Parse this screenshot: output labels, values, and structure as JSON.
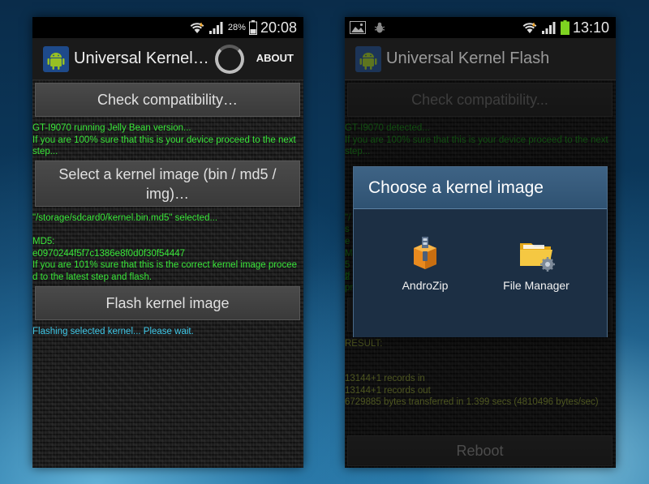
{
  "left_screen": {
    "status": {
      "battery_pct": "28%",
      "time": "20:08"
    },
    "actionbar": {
      "title": "Universal Kernel…",
      "about": "ABOUT"
    },
    "check_button": "Check compatibility…",
    "device_message": "GT-I9070 running Jelly Bean version...\nIf you are 100% sure that this is your device proceed to the next step...",
    "select_button": "Select a kernel image (bin / md5 / img)…",
    "selected_message": "\"/storage/sdcard0/kernel.bin.md5\" selected...",
    "md5_message": "MD5:\ne0970244f5f7c1386e8f0d0f30f54447\nIf you are 101% sure that this is the correct kernel image proceed to the latest step and flash.",
    "flash_button": "Flash kernel image",
    "flash_status": "Flashing selected kernel... Please wait."
  },
  "right_screen": {
    "status": {
      "time": "13:10"
    },
    "actionbar": {
      "title": "Universal Kernel Flash"
    },
    "check_button": "Check compatibility...",
    "device_message": "GT-I9070 detected...\nIf you are 100% sure that this is your device proceed to the next step...",
    "peek_fragments": {
      "line1": "\"/",
      "line2": "se",
      "line3": "M",
      "line4": "52",
      "line5": "If",
      "line6": "pr"
    },
    "result_label": "RESULT:",
    "result_output": "13144+1 records in\n13144+1 records out\n6729885 bytes transferred in 1.399 secs (4810496 bytes/sec)",
    "reboot_button": "Reboot",
    "dialog": {
      "title": "Choose a kernel image",
      "options": [
        {
          "label": "AndroZip",
          "icon": "androzip-icon"
        },
        {
          "label": "File Manager",
          "icon": "file-manager-folder-icon"
        }
      ]
    }
  },
  "colors": {
    "green_text": "#39e639",
    "cyan_text": "#3fc8e8",
    "dialog_title_bg": "#3e6385",
    "battery_green": "#7ed321",
    "android_green": "#97c024"
  }
}
